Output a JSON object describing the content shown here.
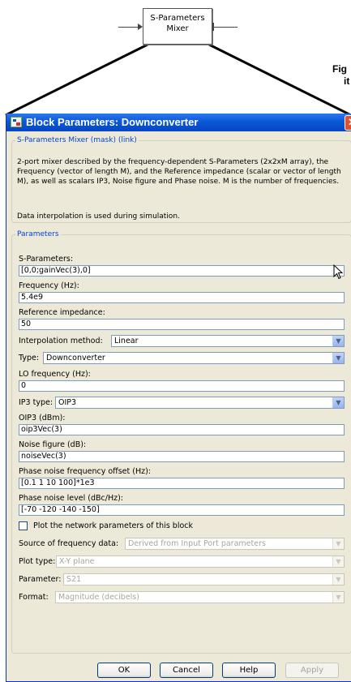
{
  "diagram": {
    "block_line1": "S-Parameters",
    "block_line2": "Mixer",
    "caption_line1": "Fig",
    "caption_line2": "it"
  },
  "dialog": {
    "title": "Block Parameters: Downconverter",
    "close_glyph": "✕",
    "mask_legend": "S-Parameters Mixer (mask) (link)",
    "description": "2-port mixer described by the frequency-dependent S-Parameters (2x2xM array), the Frequency (vector of length M), and the Reference impedance (scalar or vector of length M), as well as scalars IP3, Noise figure and Phase noise. M is the number of frequencies.",
    "description2": "Data interpolation is used during simulation.",
    "params_legend": "Parameters"
  },
  "params": {
    "sparams_label": "S-Parameters:",
    "sparams_value": "[0,0;gainVec(3),0]",
    "freq_label": "Frequency (Hz):",
    "freq_value": "5.4e9",
    "refimp_label": "Reference impedance:",
    "refimp_value": "50",
    "interp_label": "Interpolation method:",
    "interp_value": "Linear",
    "type_label": "Type:",
    "type_value": "Downconverter",
    "lo_label": "LO frequency (Hz):",
    "lo_value": "0",
    "ip3type_label": "IP3 type:",
    "ip3type_value": "OIP3",
    "oip3_label": "OIP3 (dBm):",
    "oip3_value": "oip3Vec(3)",
    "nf_label": "Noise figure (dB):",
    "nf_value": "noiseVec(3)",
    "pnoff_label": "Phase noise frequency offset (Hz):",
    "pnoff_value": "[0.1 1 10 100]*1e3",
    "pnlev_label": "Phase noise level (dBc/Hz):",
    "pnlev_value": "[-70 -120 -140 -150]",
    "plot_check_label": "Plot the network parameters of this block",
    "plot_check_checked": false,
    "source_label": "Source of frequency data:",
    "source_value": "Derived from Input Port parameters",
    "plottype_label": "Plot type:",
    "plottype_value": "X-Y plane",
    "parameter_label": "Parameter:",
    "parameter_value": "S21",
    "format_label": "Format:",
    "format_value": "Magnitude (decibels)"
  },
  "buttons": {
    "ok": "OK",
    "cancel": "Cancel",
    "help": "Help",
    "apply": "Apply"
  },
  "icons": {
    "dropdown": "chevron-down-icon",
    "cursor": "mouse-pointer-icon"
  }
}
